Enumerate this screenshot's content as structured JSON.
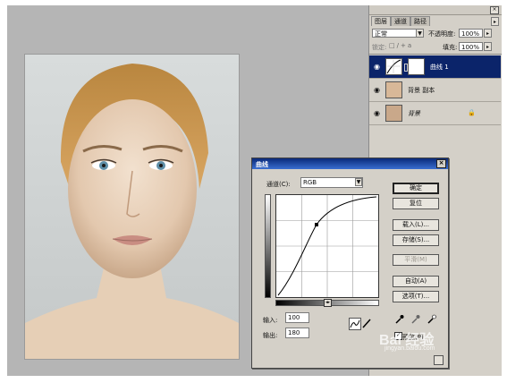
{
  "layers_panel": {
    "tabs": [
      "图层",
      "通道",
      "路径"
    ],
    "blend_mode": "正常",
    "opacity_label": "不透明度:",
    "opacity_value": "100%",
    "lock_label": "锁定:",
    "fill_label": "填充:",
    "fill_value": "100%",
    "layers": [
      {
        "name": "曲线 1",
        "selected": true
      },
      {
        "name": "背景 副本",
        "selected": false
      },
      {
        "name": "背景",
        "selected": false
      }
    ]
  },
  "curves_dialog": {
    "title": "曲线",
    "channel_label": "通道(C):",
    "channel_value": "RGB",
    "buttons": {
      "ok": "确定",
      "reset": "复位",
      "load": "载入(L)...",
      "save": "存储(S)...",
      "smooth": "平滑(M)",
      "auto": "自动(A)",
      "options": "选项(T)..."
    },
    "input_label": "输入:",
    "input_value": "100",
    "output_label": "输出:",
    "output_value": "180",
    "preview_label": "预览(P)",
    "preview_checked": true
  },
  "watermark": {
    "text": "Bai 经验",
    "url": "jingyan.baidu.com"
  },
  "colors": {
    "workspace": "#b5b5b5",
    "panel": "#d4d0c8",
    "selection": "#0b246a"
  }
}
